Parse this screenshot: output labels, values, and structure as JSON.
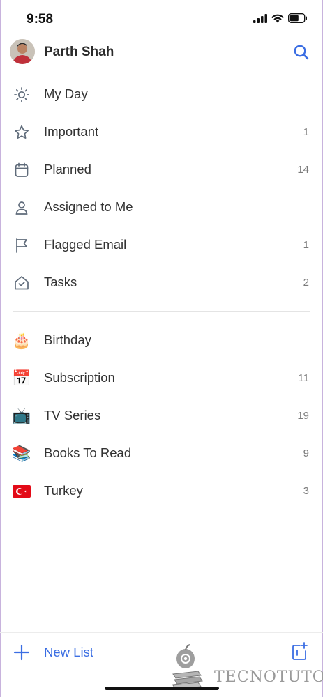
{
  "status": {
    "time": "9:58"
  },
  "header": {
    "user_name": "Parth Shah"
  },
  "smart_lists": [
    {
      "label": "My Day",
      "count": "",
      "icon": "sun-icon"
    },
    {
      "label": "Important",
      "count": "1",
      "icon": "star-icon"
    },
    {
      "label": "Planned",
      "count": "14",
      "icon": "calendar-icon"
    },
    {
      "label": "Assigned to Me",
      "count": "",
      "icon": "person-icon"
    },
    {
      "label": "Flagged Email",
      "count": "1",
      "icon": "flag-icon"
    },
    {
      "label": "Tasks",
      "count": "2",
      "icon": "home-check-icon"
    }
  ],
  "custom_lists": [
    {
      "label": "Birthday",
      "count": "",
      "emoji": "🎂"
    },
    {
      "label": "Subscription",
      "count": "11",
      "emoji": "📅"
    },
    {
      "label": "TV Series",
      "count": "19",
      "emoji": "📺"
    },
    {
      "label": "Books To Read",
      "count": "9",
      "emoji": "📚"
    },
    {
      "label": "Turkey",
      "count": "3",
      "emoji": "🇹🇷"
    }
  ],
  "footer": {
    "new_list_label": "New List"
  },
  "watermark": {
    "text": "TECNOTUTO"
  },
  "colors": {
    "accent": "#3b6ee3",
    "icon_gray": "#5f6b7a",
    "count_gray": "#7a7a7a"
  }
}
